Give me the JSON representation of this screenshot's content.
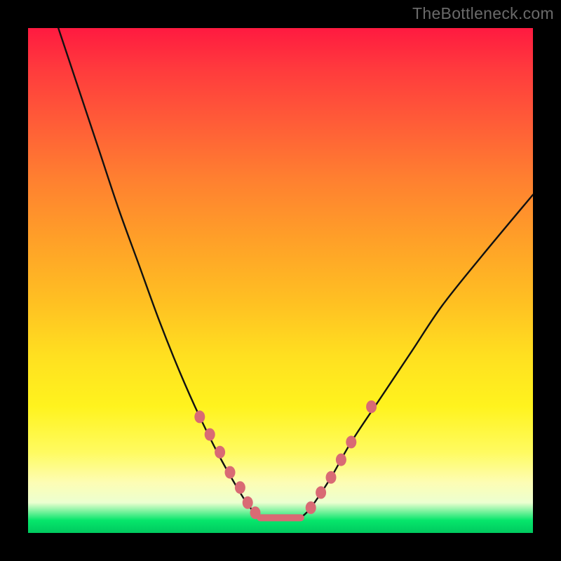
{
  "watermark": "TheBottleneck.com",
  "colors": {
    "background_black": "#000000",
    "watermark_gray": "#6a6a6a",
    "curve_stroke": "#111111",
    "marker_fill": "#d96a74",
    "grad_top": "#ff1a40",
    "grad_bottom": "#00c95f"
  },
  "chart_data": {
    "type": "line",
    "title": "",
    "xlabel": "",
    "ylabel": "",
    "xlim": [
      0,
      100
    ],
    "ylim": [
      0,
      100
    ],
    "legend": false,
    "series": [
      {
        "name": "left-curve",
        "x": [
          6,
          10,
          14,
          18,
          22,
          26,
          30,
          34,
          38,
          42,
          44,
          46
        ],
        "y": [
          100,
          88,
          76,
          64,
          53,
          42,
          32,
          23,
          15,
          8,
          5,
          3
        ]
      },
      {
        "name": "right-curve",
        "x": [
          54,
          56,
          60,
          64,
          70,
          76,
          82,
          90,
          100
        ],
        "y": [
          3,
          5,
          11,
          18,
          27,
          36,
          45,
          55,
          67
        ]
      },
      {
        "name": "valley-flat",
        "x": [
          46,
          54
        ],
        "y": [
          3,
          3
        ]
      }
    ],
    "markers": {
      "left": [
        {
          "x": 34,
          "y": 23
        },
        {
          "x": 36,
          "y": 19.5
        },
        {
          "x": 38,
          "y": 16
        },
        {
          "x": 40,
          "y": 12
        },
        {
          "x": 42,
          "y": 9
        },
        {
          "x": 43.5,
          "y": 6
        },
        {
          "x": 45,
          "y": 4
        }
      ],
      "right": [
        {
          "x": 56,
          "y": 5
        },
        {
          "x": 58,
          "y": 8
        },
        {
          "x": 60,
          "y": 11
        },
        {
          "x": 62,
          "y": 14.5
        },
        {
          "x": 64,
          "y": 18
        },
        {
          "x": 68,
          "y": 25
        }
      ]
    }
  }
}
